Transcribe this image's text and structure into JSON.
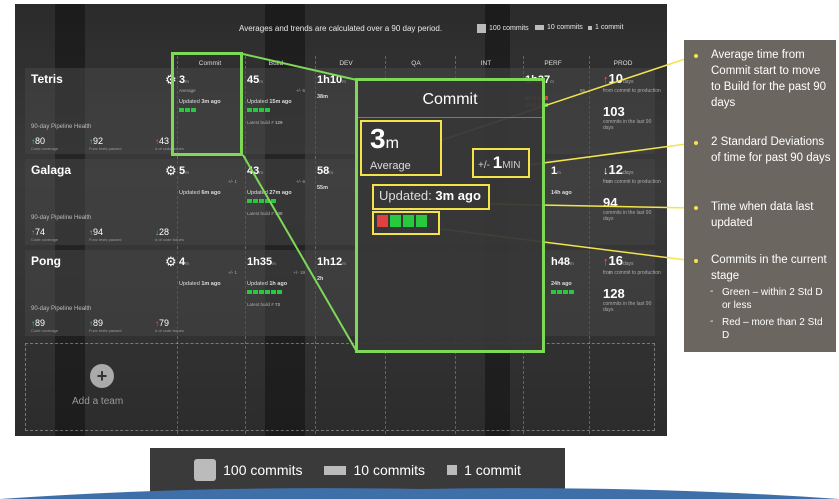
{
  "dashboard": {
    "top_note": "Averages and trends are calculated over a 90 day period.",
    "legend": [
      "100 commits",
      "10 commits",
      "1 commit"
    ],
    "columns": [
      "Commit",
      "Build",
      "DEV",
      "QA",
      "INT",
      "PERF",
      "PROD"
    ],
    "health_label": "90-day Pipeline Health",
    "metric_labels": [
      "Code coverage",
      "Func tests passed",
      "# of code issues"
    ],
    "teams": [
      {
        "name": "Tetris",
        "cov": "80",
        "func": "92",
        "issues": "43",
        "commit": {
          "val": "3",
          "unit": "m",
          "avg": "Average",
          "sd": "+/- 1",
          "sd_unit": "MIN",
          "updated": "3m ago"
        },
        "build": {
          "val": "45",
          "unit": "m",
          "sd": "+/- 6",
          "updated": "15m ago",
          "build": "129"
        },
        "dev": {
          "val": "1h10",
          "unit": "m",
          "updated": "38m"
        },
        "perf": {
          "val": "1h37",
          "unit": "m",
          "sd": "65"
        },
        "prod": {
          "val": "10",
          "unit": "days",
          "sub": "from commit to production",
          "count": "103",
          "count_sub": "commits in the last 90 days"
        }
      },
      {
        "name": "Galaga",
        "cov": "74",
        "func": "94",
        "issues": "28",
        "commit": {
          "val": "5",
          "unit": "m",
          "sd": "+/- 1",
          "updated": "6m ago"
        },
        "build": {
          "val": "43",
          "unit": "m",
          "sd": "+/- 6",
          "updated": "27m ago",
          "build": "130"
        },
        "dev": {
          "val": "58",
          "unit": "m",
          "updated": "55m"
        },
        "perf": {
          "val": "1",
          "unit": "m",
          "sd": "52",
          "updated": "14h ago"
        },
        "prod": {
          "val": "12",
          "unit": "days",
          "sub": "from commit to production",
          "count": "94",
          "count_sub": "commits in the last 90 days"
        }
      },
      {
        "name": "Pong",
        "cov": "89",
        "func": "89",
        "issues": "79",
        "commit": {
          "val": "4",
          "unit": "m",
          "sd": "+/- 1",
          "updated": "1m ago"
        },
        "build": {
          "val": "1h35",
          "unit": "m",
          "sd": "+/- 19",
          "updated": "1h ago",
          "build": "73"
        },
        "dev": {
          "val": "1h12",
          "unit": "m",
          "updated": "2h"
        },
        "perf": {
          "val": "h48",
          "unit": "m",
          "sd": "2",
          "updated": "24h ago"
        },
        "prod": {
          "val": "16",
          "unit": "days",
          "sub": "from commit to production",
          "count": "128",
          "count_sub": "commits in the last 90 days"
        }
      }
    ],
    "updated_prefix": "Updated",
    "latest_build": "Latest build #",
    "add_team": "Add a team"
  },
  "zoom": {
    "title": "Commit",
    "big": "3",
    "unit": "m",
    "avg_label": "Average",
    "sd_prefix": "+/-",
    "sd_val": "1",
    "sd_unit": "MIN",
    "updated_label": "Updated:",
    "updated_val": "3m ago"
  },
  "annotations": {
    "n1": "Average time from Commit start to move to Build for the past 90 days",
    "n2": "2 Standard Deviations of time for past 90 days",
    "n3": "Time when data last updated",
    "n4": "Commits in  the current stage",
    "n4a": "Green – within 2 Std D or less",
    "n4b": "Red – more than 2 Std D",
    "marker": "-"
  },
  "bottom_legend": [
    "100 commits",
    "10 commits",
    "1 commit"
  ],
  "colors": {
    "accent_green": "#7ed957",
    "annotation_yellow": "#f4e44a",
    "bar_green": "#27c93f",
    "bar_red": "#e04040"
  }
}
